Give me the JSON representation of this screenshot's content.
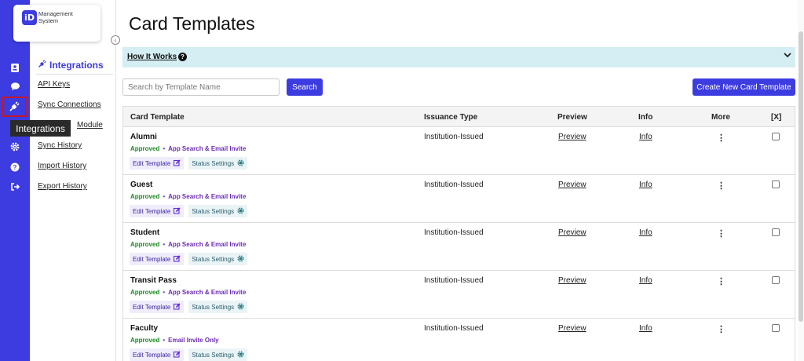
{
  "app": {
    "logo_mark": "iD",
    "logo_line1": "Management",
    "logo_line2": "System"
  },
  "rail": {
    "tooltip": "Integrations"
  },
  "subnav": {
    "title": "Integrations",
    "items": [
      {
        "label": "API Keys"
      },
      {
        "label": "Sync Connections"
      },
      {
        "label": "Module"
      },
      {
        "label": "Sync History"
      },
      {
        "label": "Import History"
      },
      {
        "label": "Export History"
      }
    ]
  },
  "page": {
    "title": "Card Templates",
    "how_it_works": "How It Works",
    "search_placeholder": "Search by Template Name",
    "search_label": "Search",
    "create_label": "Create New Card Template"
  },
  "table": {
    "headers": {
      "template": "Card Template",
      "issuance": "Issuance Type",
      "preview": "Preview",
      "info": "Info",
      "more": "More",
      "select": "[X]"
    },
    "rows": [
      {
        "name": "Alumni",
        "status": "Approved",
        "sep": "•",
        "method": "App Search & Email Invite",
        "edit": "Edit Template",
        "status_settings": "Status Settings",
        "issuance": "Institution-Issued",
        "preview": "Preview",
        "info": "Info",
        "more": "⋮"
      },
      {
        "name": "Guest",
        "status": "Approved",
        "sep": "•",
        "method": "App Search & Email Invite",
        "edit": "Edit Template",
        "status_settings": "Status Settings",
        "issuance": "Institution-Issued",
        "preview": "Preview",
        "info": "Info",
        "more": "⋮"
      },
      {
        "name": "Student",
        "status": "Approved",
        "sep": "•",
        "method": "App Search & Email Invite",
        "edit": "Edit Template",
        "status_settings": "Status Settings",
        "issuance": "Institution-Issued",
        "preview": "Preview",
        "info": "Info",
        "more": "⋮"
      },
      {
        "name": "Transit Pass",
        "status": "Approved",
        "sep": "•",
        "method": "App Search & Email Invite",
        "edit": "Edit Template",
        "status_settings": "Status Settings",
        "issuance": "Institution-Issued",
        "preview": "Preview",
        "info": "Info",
        "more": "⋮"
      },
      {
        "name": "Faculty",
        "status": "Approved",
        "sep": "•",
        "method": "Email Invite Only",
        "edit": "Edit Template",
        "status_settings": "Status Settings",
        "issuance": "Institution-Issued",
        "preview": "Preview",
        "info": "Info",
        "more": "⋮"
      }
    ]
  },
  "colors": {
    "brand": "#3d3ce0",
    "approved": "#1a8a22",
    "method": "#6b2ab5",
    "info_banner": "#d5eef3",
    "active_outline": "#c0182c"
  },
  "icons": [
    "id-badge-icon",
    "chat-icon",
    "plug-icon",
    "gear-icon",
    "help-icon",
    "logout-icon",
    "chevron-left-icon",
    "question-icon",
    "chevron-down-icon",
    "edit-icon",
    "gear-small-icon",
    "kebab-icon"
  ]
}
